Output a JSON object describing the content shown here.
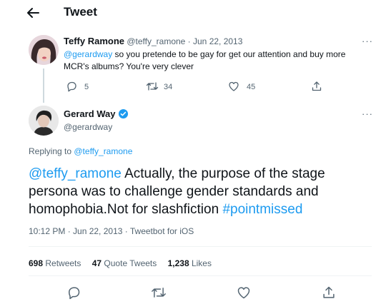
{
  "header": {
    "title": "Tweet"
  },
  "reply_tweet": {
    "display_name": "Teffy Ramone",
    "handle_date": "@teffy_ramone · Jun 22, 2013",
    "mention": "@gerardway",
    "text": " so you pretende to be gay for get our attention and buy more MCR's albums? You're very clever",
    "replies": "5",
    "retweets": "34",
    "likes": "45",
    "more": "···"
  },
  "main_tweet": {
    "display_name": "Gerard Way",
    "handle": "@gerardway",
    "more": "···",
    "replying_prefix": "Replying to ",
    "replying_handle": "@teffy_ramone",
    "mention": "@teffy_ramone",
    "text": " Actually, the purpose of the stage persona was to challenge gender standards and homophobia.Not for slashfiction ",
    "hashtag": "#pointmissed",
    "meta": "10:12 PM · Jun 22, 2013 · Tweetbot for iOS"
  },
  "stats": {
    "retweets_count": "698",
    "retweets_label": " Retweets",
    "quotes_count": "47",
    "quotes_label": " Quote Tweets",
    "likes_count": "1,238",
    "likes_label": " Likes"
  },
  "colors": {
    "link": "#1d9bf0",
    "verified": "#1d9bf0",
    "muted": "#536471"
  },
  "icons": [
    "back-arrow-icon",
    "more-icon",
    "reply-icon",
    "retweet-icon",
    "like-icon",
    "share-icon",
    "verified-badge-icon"
  ]
}
